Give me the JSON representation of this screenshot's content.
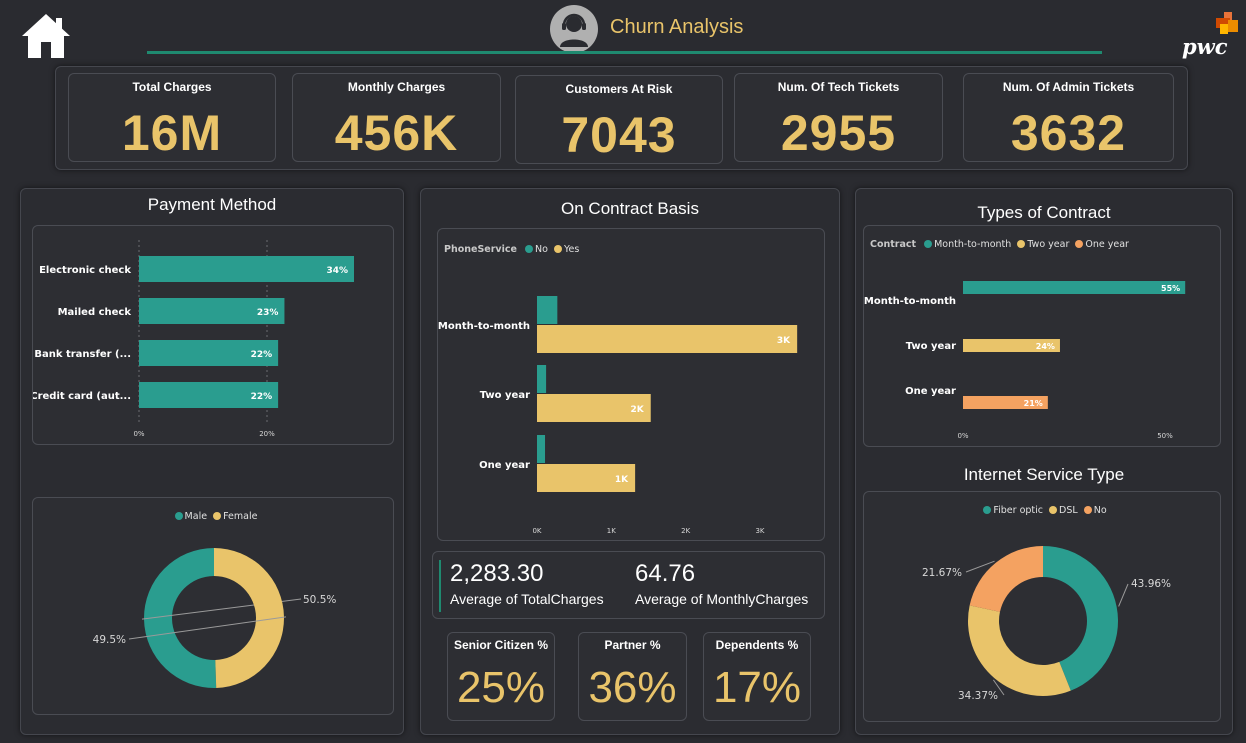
{
  "header": {
    "title": "Churn Analysis",
    "brand": "pwc",
    "colors": {
      "accent": "#e9c46a",
      "teal": "#2a9d8f",
      "orange": "#f4a261",
      "line": "#1f8a70"
    }
  },
  "kpis": [
    {
      "label": "Total Charges",
      "value": "16M"
    },
    {
      "label": "Monthly Charges",
      "value": "456K"
    },
    {
      "label": "Customers At Risk",
      "value": "7043"
    },
    {
      "label": "Num. Of Tech Tickets",
      "value": "2955"
    },
    {
      "label": "Num. Of Admin Tickets",
      "value": "3632"
    }
  ],
  "panels": {
    "payment_title": "Payment Method",
    "contract_basis_title": "On Contract Basis",
    "types_title": "Types of Contract",
    "internet_title": "Internet Service Type"
  },
  "averages": {
    "total_value": "2,283.30",
    "total_label": "Average of TotalCharges",
    "monthly_value": "64.76",
    "monthly_label": "Average of MonthlyCharges"
  },
  "percent_cards": [
    {
      "label": "Senior Citizen %",
      "value": "25%"
    },
    {
      "label": "Partner %",
      "value": "36%"
    },
    {
      "label": "Dependents %",
      "value": "17%"
    }
  ],
  "chart_data": [
    {
      "id": "payment",
      "type": "bar",
      "orientation": "horizontal",
      "categories": [
        "Electronic check",
        "Mailed check",
        "Bank transfer (...",
        "Credit card (aut..."
      ],
      "values": [
        34,
        23,
        22,
        22
      ],
      "labels": [
        "34%",
        "23%",
        "22%",
        "22%"
      ],
      "xticks": [
        "0%",
        "20%"
      ],
      "xlim": [
        0,
        34
      ],
      "grid": true
    },
    {
      "id": "gender",
      "type": "pie",
      "donut": true,
      "series": [
        {
          "name": "Male",
          "value": 50.5,
          "label": "50.5%",
          "color": "#2a9d8f"
        },
        {
          "name": "Female",
          "value": 49.5,
          "label": "49.5%",
          "color": "#e9c46a"
        }
      ],
      "legend": "top"
    },
    {
      "id": "contract_basis",
      "type": "bar",
      "orientation": "horizontal",
      "legend_title": "PhoneService",
      "categories": [
        "Month-to-month",
        "Two year",
        "One year"
      ],
      "series": [
        {
          "name": "No",
          "color": "#2a9d8f",
          "values": [
            380,
            170,
            150
          ],
          "labels": [
            "",
            "",
            ""
          ]
        },
        {
          "name": "Yes",
          "color": "#e9c46a",
          "values": [
            3500,
            1530,
            1320
          ],
          "labels": [
            "3K",
            "2K",
            "1K"
          ]
        }
      ],
      "xticks": [
        "0K",
        "1K",
        "2K",
        "3K"
      ],
      "xlim": [
        0,
        3500
      ],
      "legend": "top-left"
    },
    {
      "id": "types_contract",
      "type": "bar",
      "orientation": "horizontal",
      "legend_title": "Contract",
      "categories": [
        "Month-to-month",
        "Two year",
        "One year"
      ],
      "series": [
        {
          "name": "Month-to-month",
          "color": "#2a9d8f"
        },
        {
          "name": "Two year",
          "color": "#e9c46a"
        },
        {
          "name": "One year",
          "color": "#f4a261"
        }
      ],
      "values": [
        55,
        24,
        21
      ],
      "labels": [
        "55%",
        "24%",
        "21%"
      ],
      "xticks": [
        "0%",
        "50%"
      ],
      "xlim": [
        0,
        55
      ],
      "legend": "top-left"
    },
    {
      "id": "internet",
      "type": "pie",
      "donut": true,
      "series": [
        {
          "name": "Fiber optic",
          "value": 43.96,
          "label": "43.96%",
          "color": "#2a9d8f"
        },
        {
          "name": "DSL",
          "value": 34.37,
          "label": "34.37%",
          "color": "#e9c46a"
        },
        {
          "name": "No",
          "value": 21.67,
          "label": "21.67%",
          "color": "#f4a261"
        }
      ],
      "legend": "top"
    }
  ]
}
